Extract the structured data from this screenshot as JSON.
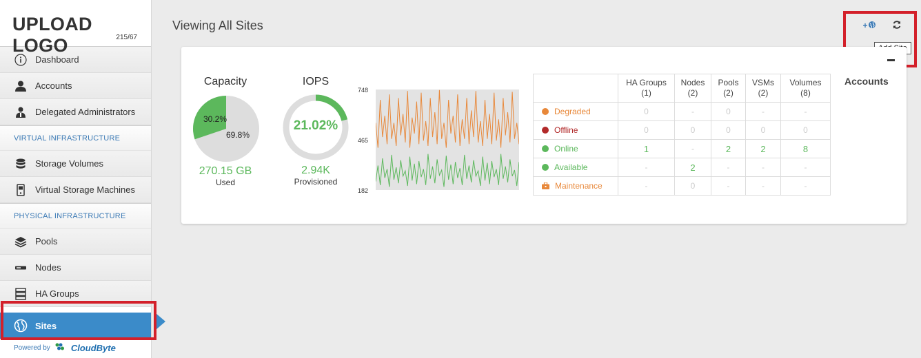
{
  "sidebar": {
    "logo": "UPLOAD LOGO",
    "logo_dim": "215/67",
    "items_top": [
      {
        "label": "Dashboard",
        "icon": "info-icon"
      },
      {
        "label": "Accounts",
        "icon": "user-icon"
      },
      {
        "label": "Delegated Administrators",
        "icon": "delegate-icon"
      }
    ],
    "section_virtual": "VIRTUAL INFRASTRUCTURE",
    "items_virtual": [
      {
        "label": "Storage Volumes",
        "icon": "database-icon"
      },
      {
        "label": "Virtual Storage Machines",
        "icon": "server-icon"
      }
    ],
    "section_physical": "PHYSICAL INFRASTRUCTURE",
    "items_physical": [
      {
        "label": "Pools",
        "icon": "layers-icon"
      },
      {
        "label": "Nodes",
        "icon": "node-icon"
      },
      {
        "label": "HA Groups",
        "icon": "ha-groups-icon"
      }
    ],
    "active_item": {
      "label": "Sites",
      "icon": "globe-icon"
    },
    "powered_by": "Powered by",
    "brand": "CloudByte"
  },
  "header": {
    "title": "Viewing All Sites",
    "add_site_icon": "+",
    "tooltip": "Add Site"
  },
  "capacity": {
    "title": "Capacity",
    "used_pct_label": "30.2%",
    "free_pct_label": "69.8%",
    "used_fraction": 0.302,
    "value": "270.15 GB",
    "sub": "Used",
    "colors": {
      "used": "#5cb85c",
      "free": "#dddddd"
    }
  },
  "iops": {
    "title": "IOPS",
    "percent_label": "21.02%",
    "fraction": 0.2102,
    "value": "2.94K",
    "sub": "Provisioned"
  },
  "chart_data": {
    "type": "line",
    "ylim": [
      182,
      748
    ],
    "y_ticks": [
      "748",
      "465",
      "182"
    ],
    "series": [
      {
        "color": "#e8883a",
        "values": [
          560,
          420,
          690,
          480,
          600,
          440,
          720,
          470,
          560,
          430,
          700,
          490,
          610,
          450,
          740,
          420,
          590,
          500,
          680,
          440,
          730,
          460,
          570,
          430,
          700,
          480,
          620,
          440,
          745,
          470,
          560,
          420,
          690,
          500,
          600,
          450,
          720,
          430,
          580,
          470,
          700,
          440,
          630,
          480,
          740,
          450,
          570,
          430,
          690,
          470,
          610,
          440,
          730,
          460,
          580,
          420,
          700,
          490,
          620,
          450,
          735,
          470,
          560,
          440
        ]
      },
      {
        "color": "#5cb85c",
        "values": [
          230,
          320,
          210,
          360,
          250,
          300,
          200,
          380,
          240,
          310,
          220,
          350,
          260,
          290,
          205,
          370,
          235,
          330,
          215,
          345,
          255,
          300,
          210,
          385,
          245,
          315,
          220,
          355,
          265,
          295,
          200,
          375,
          240,
          325,
          215,
          340,
          250,
          305,
          210,
          380,
          245,
          320,
          225,
          350,
          260,
          290,
          205,
          370,
          235,
          335,
          215,
          345,
          255,
          300,
          210,
          385,
          245,
          315,
          225,
          355,
          260,
          295,
          205,
          340
        ]
      }
    ]
  },
  "status_table": {
    "headers": [
      {
        "name": "HA Groups",
        "count": "(1)"
      },
      {
        "name": "Nodes",
        "count": "(2)"
      },
      {
        "name": "Pools",
        "count": "(2)"
      },
      {
        "name": "VSMs",
        "count": "(2)"
      },
      {
        "name": "Volumes",
        "count": "(8)"
      }
    ],
    "rows": [
      {
        "label": "Degraded",
        "color": "#e8883a",
        "shape": "dot",
        "cells": [
          "0",
          "-",
          "0",
          "-",
          "-"
        ]
      },
      {
        "label": "Offline",
        "color": "#b22a2a",
        "shape": "dot",
        "cells": [
          "0",
          "0",
          "0",
          "0",
          "0"
        ]
      },
      {
        "label": "Online",
        "color": "#5cb85c",
        "shape": "dot",
        "cells": [
          "1",
          "-",
          "2",
          "2",
          "8"
        ]
      },
      {
        "label": "Available",
        "color": "#5cb85c",
        "shape": "dot",
        "cells": [
          "-",
          "2",
          "-",
          "-",
          "-"
        ]
      },
      {
        "label": "Maintenance",
        "color": "#e8883a",
        "shape": "briefcase",
        "cells": [
          "-",
          "0",
          "-",
          "-",
          "-"
        ]
      }
    ]
  },
  "accounts_panel": {
    "title": "Accounts"
  }
}
